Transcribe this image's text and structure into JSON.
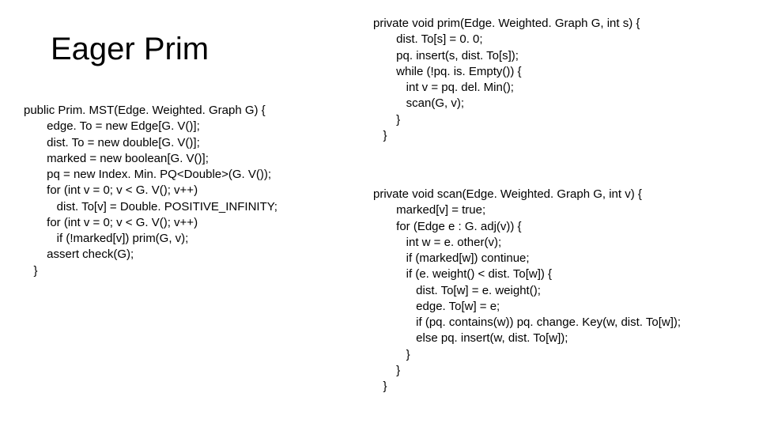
{
  "title": "Eager Prim",
  "left_code": "public Prim. MST(Edge. Weighted. Graph G) {\n       edge. To = new Edge[G. V()];\n       dist. To = new double[G. V()];\n       marked = new boolean[G. V()];\n       pq = new Index. Min. PQ<Double>(G. V());\n       for (int v = 0; v < G. V(); v++)\n          dist. To[v] = Double. POSITIVE_INFINITY;\n       for (int v = 0; v < G. V(); v++)\n          if (!marked[v]) prim(G, v);\n       assert check(G);\n   }",
  "right_code_1": "private void prim(Edge. Weighted. Graph G, int s) {\n       dist. To[s] = 0. 0;\n       pq. insert(s, dist. To[s]);\n       while (!pq. is. Empty()) {\n          int v = pq. del. Min();\n          scan(G, v);\n       }\n   }",
  "right_code_2": "private void scan(Edge. Weighted. Graph G, int v) {\n       marked[v] = true;\n       for (Edge e : G. adj(v)) {\n          int w = e. other(v);\n          if (marked[w]) continue;\n          if (e. weight() < dist. To[w]) {\n             dist. To[w] = e. weight();\n             edge. To[w] = e;\n             if (pq. contains(w)) pq. change. Key(w, dist. To[w]);\n             else pq. insert(w, dist. To[w]);\n          }\n       }\n   }"
}
